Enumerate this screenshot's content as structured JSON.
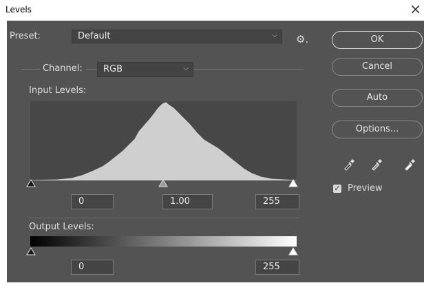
{
  "window": {
    "title": "Levels",
    "close_icon": "×"
  },
  "preset": {
    "label": "Preset:",
    "value": "Default",
    "chevron": "⌵",
    "gear_icon": "⚙."
  },
  "buttons": {
    "ok": "OK",
    "cancel": "Cancel",
    "auto": "Auto",
    "options": "Options..."
  },
  "channel": {
    "label": "Channel:",
    "value": "RGB",
    "chevron": "⌵"
  },
  "input_levels": {
    "label": "Input Levels:",
    "black": "0",
    "gamma": "1.00",
    "white": "255"
  },
  "output_levels": {
    "label": "Output Levels:",
    "black": "0",
    "white": "255"
  },
  "preview": {
    "label": "Preview",
    "checked": true,
    "check_icon": "✓"
  },
  "colors": {
    "panel": "#535353",
    "histogram_bg": "#474747",
    "histogram_fill": "#cfcfcf"
  }
}
